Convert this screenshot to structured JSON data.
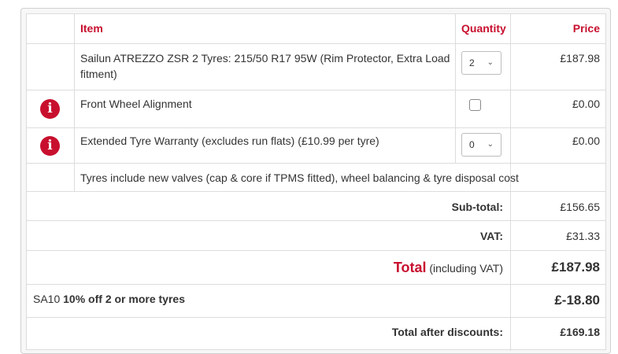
{
  "header": {
    "item": "Item",
    "quantity": "Quantity",
    "price": "Price"
  },
  "rows": [
    {
      "item_line1": "Sailun ATREZZO ZSR 2 Tyres: 215/50 R17 95W (Rim Protector, Extra Load",
      "item_line2": "fitment)",
      "quantity_value": "2",
      "price": "£187.98"
    },
    {
      "icon": "info-icon",
      "item": "Front Wheel Alignment",
      "checked": false,
      "price": "£0.00"
    },
    {
      "icon": "info-icon",
      "item": "Extended Tyre Warranty (excludes run flats) (£10.99 per tyre)",
      "quantity_value": "0",
      "price": "£0.00"
    }
  ],
  "note": "Tyres include new valves (cap & core if TPMS fitted), wheel balancing & tyre disposal cost",
  "summary": {
    "subtotal_label": "Sub-total:",
    "subtotal_value": "£156.65",
    "vat_label": "VAT:",
    "vat_value": "£31.33",
    "total_word": "Total",
    "total_suffix": "(including VAT)",
    "total_value": "£187.98"
  },
  "discount": {
    "code": "SA10",
    "description": "10% off 2 or more tyres",
    "value": "£-18.80"
  },
  "after_discounts": {
    "label": "Total after discounts:",
    "value": "£169.18"
  },
  "colors": {
    "accent": "#c8102e",
    "border": "#dcdcdc",
    "text": "#333333"
  }
}
